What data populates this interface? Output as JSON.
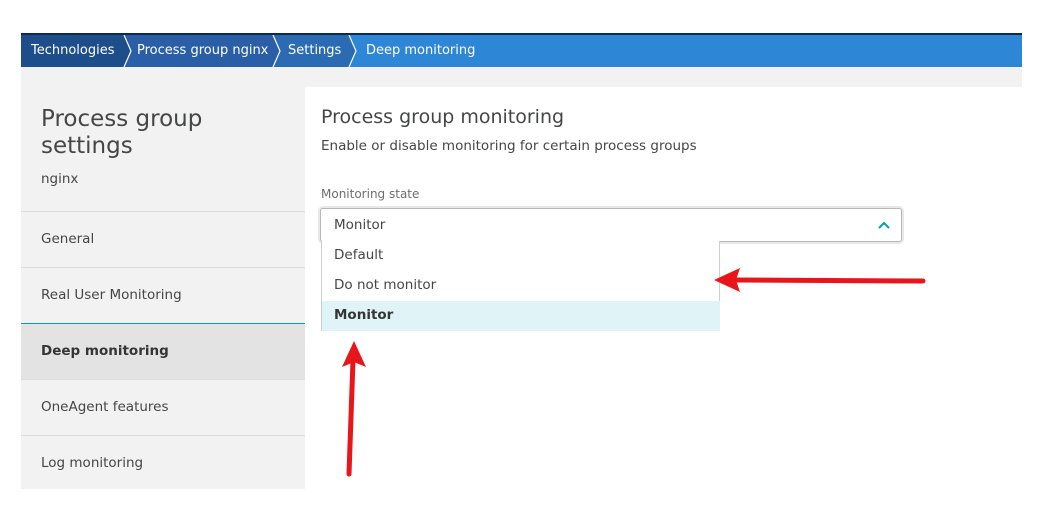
{
  "breadcrumb": {
    "items": [
      "Technologies",
      "Process group nginx",
      "Settings",
      "Deep monitoring"
    ],
    "colors": {
      "dark": "#1e4d8c",
      "mid": "#2a6bb4",
      "current": "#2e86d6"
    }
  },
  "sidebar": {
    "title": "Process group settings",
    "subtitle": "nginx",
    "items": [
      {
        "label": "General"
      },
      {
        "label": "Real User Monitoring"
      },
      {
        "label": "Deep monitoring",
        "active": true
      },
      {
        "label": "OneAgent features"
      },
      {
        "label": "Log monitoring"
      }
    ]
  },
  "main": {
    "title": "Process group monitoring",
    "description": "Enable or disable monitoring for certain process groups",
    "field_label": "Monitoring state",
    "select_value": "Monitor",
    "select_icon": "chevron-up-icon",
    "options": [
      {
        "label": "Default"
      },
      {
        "label": "Do not monitor"
      },
      {
        "label": "Monitor",
        "selected": true
      }
    ]
  },
  "annotations": {
    "arrow_color": "#e8161b"
  }
}
